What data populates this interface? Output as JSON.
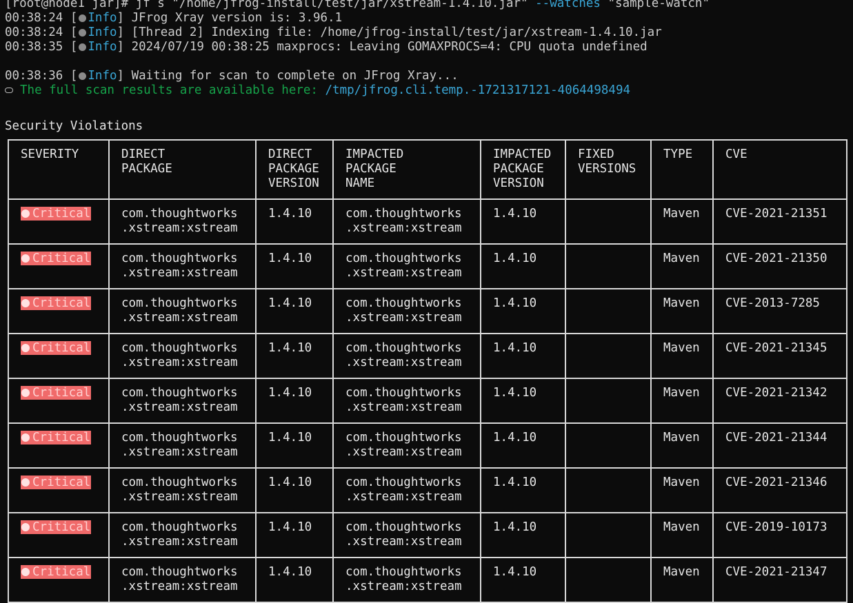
{
  "terminal": {
    "prompt": "[root@node1 jar]# ",
    "command_prefix": "jf s \"/home/jfrog-install/test/jar/xstream-1.4.10.jar\" ",
    "command_flag": "--watches",
    "command_arg": " \"sample-watch\"",
    "logs": [
      {
        "time": "00:38:24",
        "level": "Info",
        "message": "JFrog Xray version is: 3.96.1"
      },
      {
        "time": "00:38:24",
        "level": "Info",
        "message": "[Thread 2] Indexing file: /home/jfrog-install/test/jar/xstream-1.4.10.jar"
      },
      {
        "time": "00:38:35",
        "level": "Info",
        "message": "2024/07/19 00:38:25 maxprocs: Leaving GOMAXPROCS=4: CPU quota undefined"
      },
      {
        "time": "00:38:36",
        "level": "Info",
        "message": "Waiting for scan to complete on JFrog Xray..."
      }
    ],
    "results_text": "The full scan results are available here: ",
    "results_path": "/tmp/jfrog.cli.temp.-1721317121-4064498494",
    "section_title": "Security Violations"
  },
  "table": {
    "headers": [
      "SEVERITY",
      "DIRECT\nPACKAGE",
      "DIRECT\nPACKAGE\nVERSION",
      "IMPACTED\nPACKAGE\nNAME",
      "IMPACTED\nPACKAGE\nVERSION",
      "FIXED\nVERSIONS",
      "TYPE",
      "CVE"
    ],
    "rows": [
      {
        "severity": "Critical",
        "direct_package": "com.thoughtworks\n.xstream:xstream",
        "direct_version": "1.4.10",
        "impacted_name": "com.thoughtworks\n.xstream:xstream",
        "impacted_version": "1.4.10",
        "fixed_versions": "",
        "type": "Maven",
        "cve": "CVE-2021-21351"
      },
      {
        "severity": "Critical",
        "direct_package": "com.thoughtworks\n.xstream:xstream",
        "direct_version": "1.4.10",
        "impacted_name": "com.thoughtworks\n.xstream:xstream",
        "impacted_version": "1.4.10",
        "fixed_versions": "",
        "type": "Maven",
        "cve": "CVE-2021-21350"
      },
      {
        "severity": "Critical",
        "direct_package": "com.thoughtworks\n.xstream:xstream",
        "direct_version": "1.4.10",
        "impacted_name": "com.thoughtworks\n.xstream:xstream",
        "impacted_version": "1.4.10",
        "fixed_versions": "",
        "type": "Maven",
        "cve": "CVE-2013-7285"
      },
      {
        "severity": "Critical",
        "direct_package": "com.thoughtworks\n.xstream:xstream",
        "direct_version": "1.4.10",
        "impacted_name": "com.thoughtworks\n.xstream:xstream",
        "impacted_version": "1.4.10",
        "fixed_versions": "",
        "type": "Maven",
        "cve": "CVE-2021-21345"
      },
      {
        "severity": "Critical",
        "direct_package": "com.thoughtworks\n.xstream:xstream",
        "direct_version": "1.4.10",
        "impacted_name": "com.thoughtworks\n.xstream:xstream",
        "impacted_version": "1.4.10",
        "fixed_versions": "",
        "type": "Maven",
        "cve": "CVE-2021-21342"
      },
      {
        "severity": "Critical",
        "direct_package": "com.thoughtworks\n.xstream:xstream",
        "direct_version": "1.4.10",
        "impacted_name": "com.thoughtworks\n.xstream:xstream",
        "impacted_version": "1.4.10",
        "fixed_versions": "",
        "type": "Maven",
        "cve": "CVE-2021-21344"
      },
      {
        "severity": "Critical",
        "direct_package": "com.thoughtworks\n.xstream:xstream",
        "direct_version": "1.4.10",
        "impacted_name": "com.thoughtworks\n.xstream:xstream",
        "impacted_version": "1.4.10",
        "fixed_versions": "",
        "type": "Maven",
        "cve": "CVE-2021-21346"
      },
      {
        "severity": "Critical",
        "direct_package": "com.thoughtworks\n.xstream:xstream",
        "direct_version": "1.4.10",
        "impacted_name": "com.thoughtworks\n.xstream:xstream",
        "impacted_version": "1.4.10",
        "fixed_versions": "",
        "type": "Maven",
        "cve": "CVE-2019-10173"
      },
      {
        "severity": "Critical",
        "direct_package": "com.thoughtworks\n.xstream:xstream",
        "direct_version": "1.4.10",
        "impacted_name": "com.thoughtworks\n.xstream:xstream",
        "impacted_version": "1.4.10",
        "fixed_versions": "",
        "type": "Maven",
        "cve": "CVE-2021-21347"
      }
    ]
  },
  "colors": {
    "background": "#0c0c0c",
    "info": "#3aa6d6",
    "success": "#16a34a",
    "critical_badge": "#f06a6a"
  },
  "icons": {
    "log_dot": "status-dot-icon",
    "link": "link-icon",
    "severity": "skull-icon"
  }
}
